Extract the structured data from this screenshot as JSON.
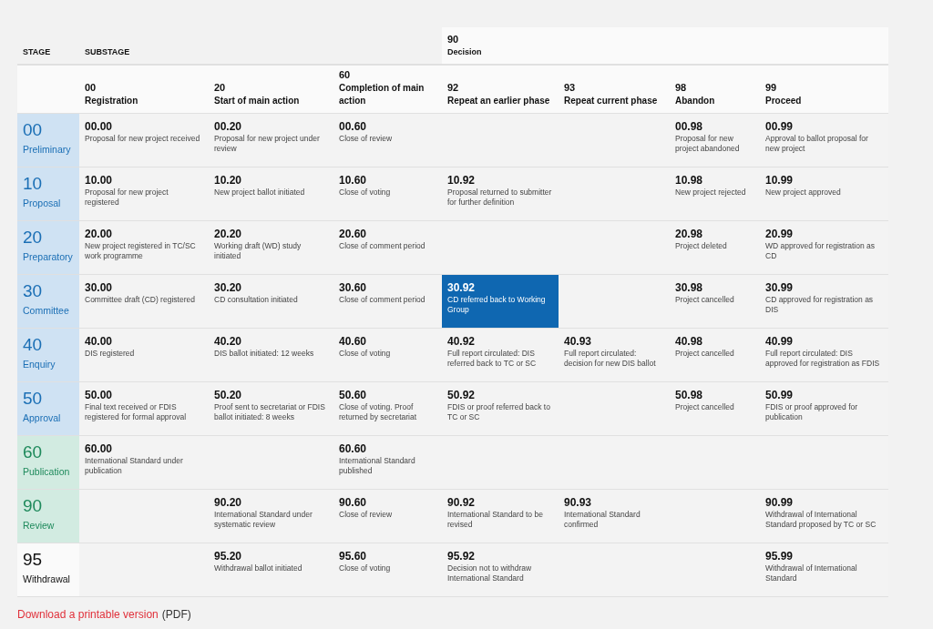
{
  "header": {
    "stage_label": "STAGE",
    "substage_label": "SUBSTAGE",
    "decision": {
      "code": "90",
      "name": "Decision"
    }
  },
  "columns": [
    {
      "code": "00",
      "name": "Registration"
    },
    {
      "code": "20",
      "name": "Start of main action"
    },
    {
      "code": "60",
      "name": "Completion of main action"
    },
    {
      "code": "92",
      "name": "Repeat an earlier phase"
    },
    {
      "code": "93",
      "name": "Repeat current phase"
    },
    {
      "code": "98",
      "name": "Abandon"
    },
    {
      "code": "99",
      "name": "Proceed"
    }
  ],
  "stages": [
    {
      "code": "00",
      "name": "Preliminary",
      "kind": "development",
      "cells": [
        {
          "code": "00.00",
          "desc": "Proposal for new project received",
          "selected": false
        },
        {
          "code": "00.20",
          "desc": "Proposal for new project under review",
          "selected": false
        },
        {
          "code": "00.60",
          "desc": "Close of review",
          "selected": false
        },
        null,
        null,
        {
          "code": "00.98",
          "desc": "Proposal for new project abandoned",
          "selected": false
        },
        {
          "code": "00.99",
          "desc": "Approval to ballot proposal for new project",
          "selected": false
        }
      ]
    },
    {
      "code": "10",
      "name": "Proposal",
      "kind": "development",
      "cells": [
        {
          "code": "10.00",
          "desc": "Proposal for new project registered",
          "selected": false
        },
        {
          "code": "10.20",
          "desc": "New project ballot initiated",
          "selected": false
        },
        {
          "code": "10.60",
          "desc": "Close of voting",
          "selected": false
        },
        {
          "code": "10.92",
          "desc": "Proposal returned to submitter for further definition",
          "selected": false
        },
        null,
        {
          "code": "10.98",
          "desc": "New project rejected",
          "selected": false
        },
        {
          "code": "10.99",
          "desc": "New project approved",
          "selected": false
        }
      ]
    },
    {
      "code": "20",
      "name": "Preparatory",
      "kind": "development",
      "cells": [
        {
          "code": "20.00",
          "desc": "New project registered in TC/SC work programme",
          "selected": false
        },
        {
          "code": "20.20",
          "desc": "Working draft (WD) study initiated",
          "selected": false
        },
        {
          "code": "20.60",
          "desc": "Close of comment period",
          "selected": false
        },
        null,
        null,
        {
          "code": "20.98",
          "desc": "Project deleted",
          "selected": false
        },
        {
          "code": "20.99",
          "desc": "WD approved for registration as CD",
          "selected": false
        }
      ]
    },
    {
      "code": "30",
      "name": "Committee",
      "kind": "development",
      "cells": [
        {
          "code": "30.00",
          "desc": "Committee draft (CD) registered",
          "selected": false
        },
        {
          "code": "30.20",
          "desc": "CD consultation initiated",
          "selected": false
        },
        {
          "code": "30.60",
          "desc": "Close of comment period",
          "selected": false
        },
        {
          "code": "30.92",
          "desc": "CD referred back to Working Group",
          "selected": true
        },
        null,
        {
          "code": "30.98",
          "desc": "Project cancelled",
          "selected": false
        },
        {
          "code": "30.99",
          "desc": "CD approved for registration as DIS",
          "selected": false
        }
      ]
    },
    {
      "code": "40",
      "name": "Enquiry",
      "kind": "development",
      "cells": [
        {
          "code": "40.00",
          "desc": "DIS registered",
          "selected": false
        },
        {
          "code": "40.20",
          "desc": "DIS ballot initiated: 12 weeks",
          "selected": false
        },
        {
          "code": "40.60",
          "desc": "Close of voting",
          "selected": false
        },
        {
          "code": "40.92",
          "desc": "Full report circulated: DIS referred back to TC or SC",
          "selected": false
        },
        {
          "code": "40.93",
          "desc": "Full report circulated: decision for new DIS ballot",
          "selected": false
        },
        {
          "code": "40.98",
          "desc": "Project cancelled",
          "selected": false
        },
        {
          "code": "40.99",
          "desc": "Full report circulated: DIS approved for registration as FDIS",
          "selected": false
        }
      ]
    },
    {
      "code": "50",
      "name": "Approval",
      "kind": "development",
      "cells": [
        {
          "code": "50.00",
          "desc": "Final text received or FDIS registered for formal approval",
          "selected": false
        },
        {
          "code": "50.20",
          "desc": "Proof sent to secretariat or FDIS ballot initiated: 8 weeks",
          "selected": false
        },
        {
          "code": "50.60",
          "desc": "Close of voting. Proof returned by secretariat",
          "selected": false
        },
        {
          "code": "50.92",
          "desc": "FDIS or proof referred back to TC or SC",
          "selected": false
        },
        null,
        {
          "code": "50.98",
          "desc": "Project cancelled",
          "selected": false
        },
        {
          "code": "50.99",
          "desc": "FDIS or proof approved for publication",
          "selected": false
        }
      ]
    },
    {
      "code": "60",
      "name": "Publication",
      "kind": "published",
      "cells": [
        {
          "code": "60.00",
          "desc": "International Standard under publication",
          "selected": false
        },
        null,
        {
          "code": "60.60",
          "desc": "International Standard published",
          "selected": false
        },
        null,
        null,
        null,
        null
      ]
    },
    {
      "code": "90",
      "name": "Review",
      "kind": "published",
      "cells": [
        null,
        {
          "code": "90.20",
          "desc": "International Standard under systematic review",
          "selected": false
        },
        {
          "code": "90.60",
          "desc": "Close of review",
          "selected": false
        },
        {
          "code": "90.92",
          "desc": "International Standard to be revised",
          "selected": false
        },
        {
          "code": "90.93",
          "desc": "International Standard confirmed",
          "selected": false
        },
        null,
        {
          "code": "90.99",
          "desc": "Withdrawal of International Standard proposed by TC or SC",
          "selected": false
        }
      ]
    },
    {
      "code": "95",
      "name": "Withdrawal",
      "kind": "withdrawal",
      "cells": [
        null,
        {
          "code": "95.20",
          "desc": "Withdrawal ballot initiated",
          "selected": false
        },
        {
          "code": "95.60",
          "desc": "Close of voting",
          "selected": false
        },
        {
          "code": "95.92",
          "desc": "Decision not to withdraw International Standard",
          "selected": false
        },
        null,
        null,
        {
          "code": "95.99",
          "desc": "Withdrawal of International Standard",
          "selected": false
        }
      ]
    }
  ],
  "download": {
    "link": "Download a printable version",
    "suffix": "(PDF)"
  }
}
